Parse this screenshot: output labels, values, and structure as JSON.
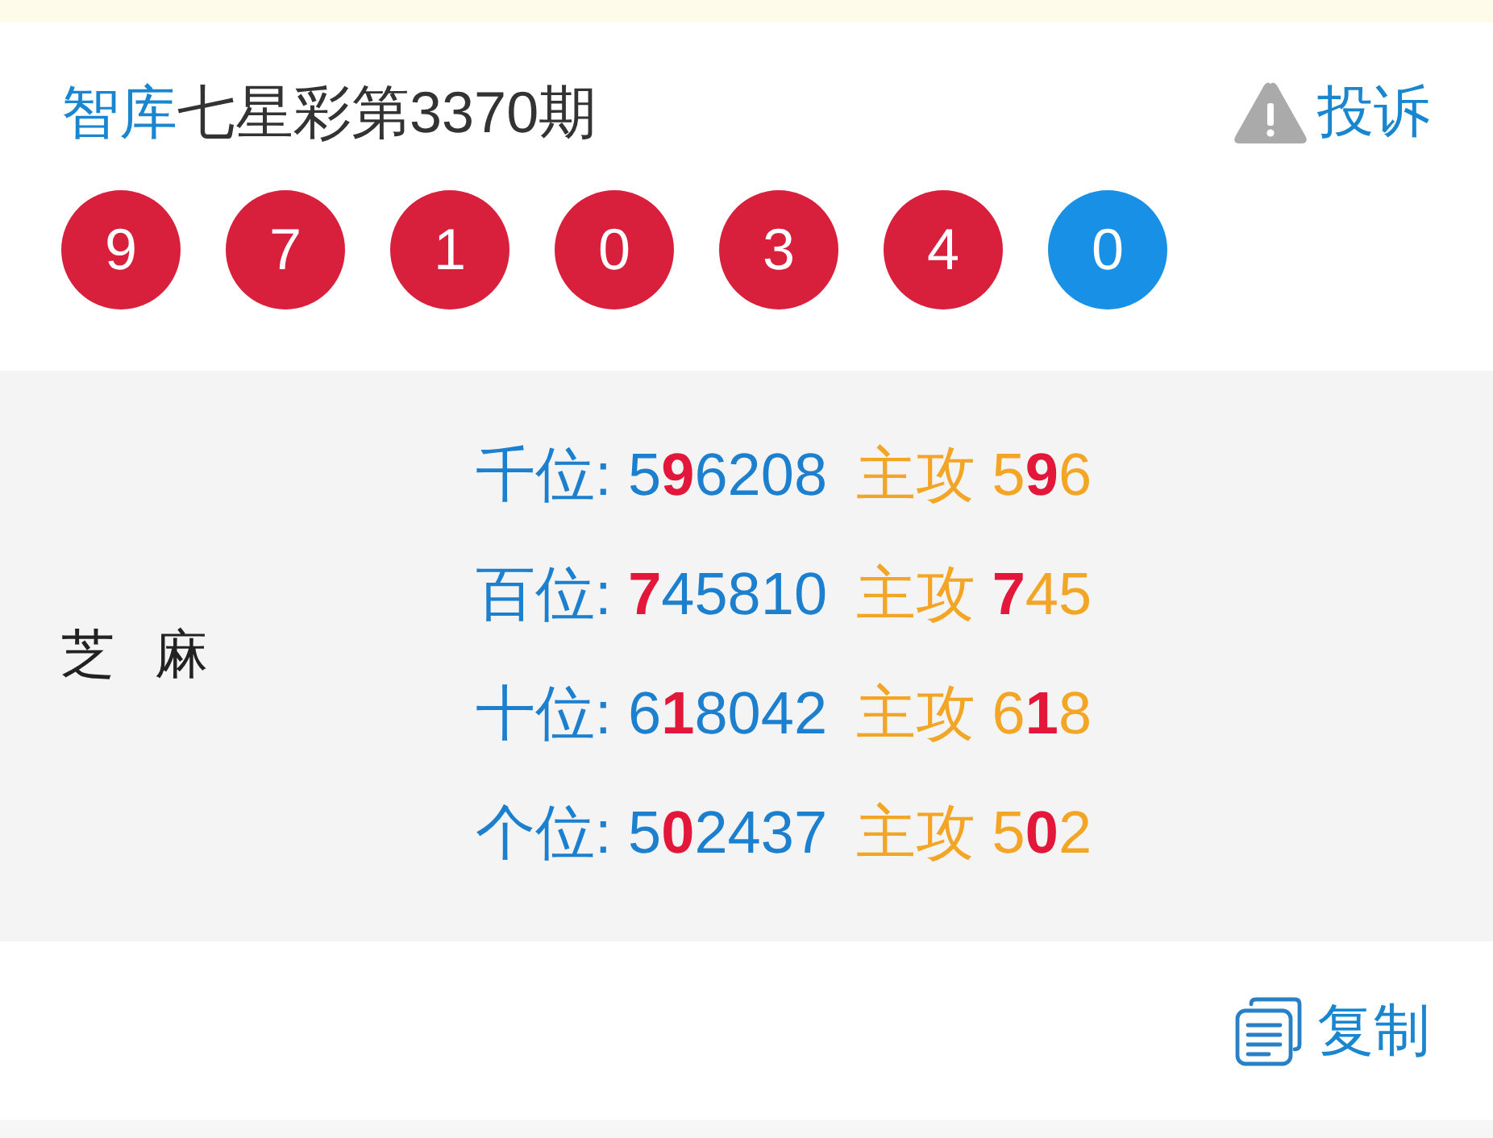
{
  "header": {
    "source": "智库",
    "title": "七星彩第3370期",
    "complaint": "投诉"
  },
  "balls": [
    {
      "number": "9",
      "color": "#d81f3c"
    },
    {
      "number": "7",
      "color": "#d81f3c"
    },
    {
      "number": "1",
      "color": "#d81f3c"
    },
    {
      "number": "0",
      "color": "#d81f3c"
    },
    {
      "number": "3",
      "color": "#d81f3c"
    },
    {
      "number": "4",
      "color": "#d81f3c"
    },
    {
      "number": "0",
      "color": "#1890e6"
    }
  ],
  "panel": {
    "label": "芝 麻",
    "rows": [
      {
        "position": "千位: 5**9**6208",
        "focus": "主攻 5**9**6"
      },
      {
        "position": "百位: **7**45810",
        "focus": "主攻 **7**45"
      },
      {
        "position": "十位: 6**1**8042",
        "focus": "主攻 6**1**8"
      },
      {
        "position": "个位: 5**0**2437",
        "focus": "主攻 5**0**2"
      }
    ]
  },
  "footer": {
    "copy": "复制"
  }
}
